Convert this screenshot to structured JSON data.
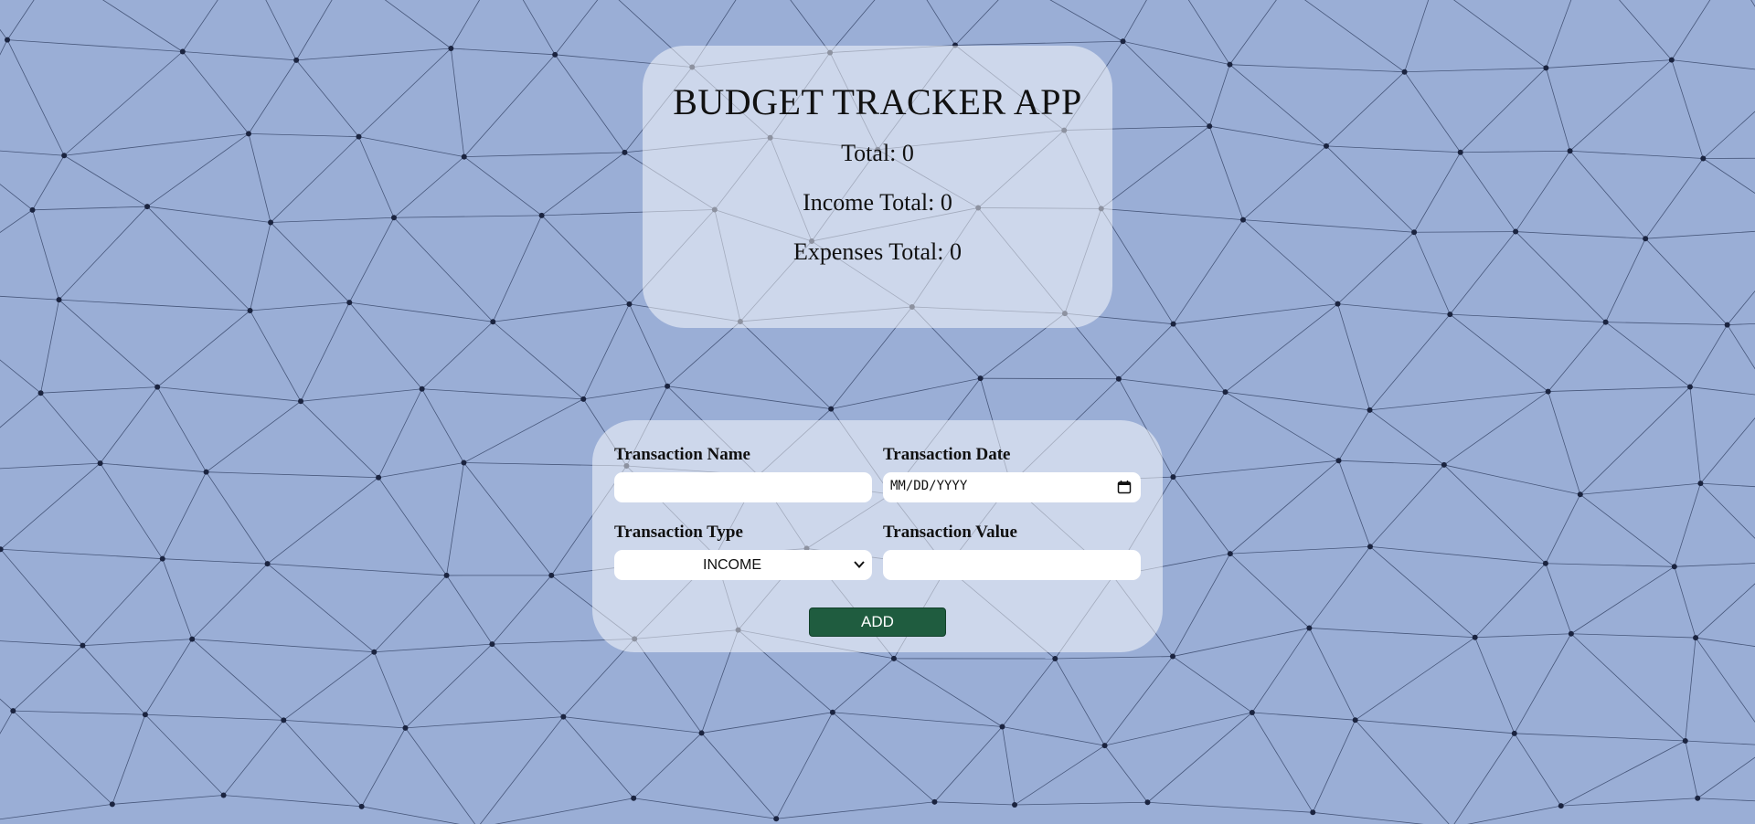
{
  "app": {
    "title": "BUDGET TRACKER APP"
  },
  "summary": {
    "total": "Total: 0",
    "income_total": "Income Total: 0",
    "expenses_total": "Expenses Total: 0"
  },
  "form": {
    "name_label": "Transaction Name",
    "name_value": "",
    "date_label": "Transaction Date",
    "date_placeholder": "MM/DD/YYYY",
    "type_label": "Transaction Type",
    "type_selected": "INCOME",
    "value_label": "Transaction Value",
    "value_value": "",
    "add_label": "ADD"
  },
  "colors": {
    "background": "#9aaed6",
    "card": "rgba(255,255,255,0.5)",
    "button": "#1f5c3f",
    "network_line": "#2b3a5c",
    "network_node": "#1b2440"
  },
  "icons": {
    "date": "calendar-icon",
    "select": "chevron-down-icon"
  }
}
